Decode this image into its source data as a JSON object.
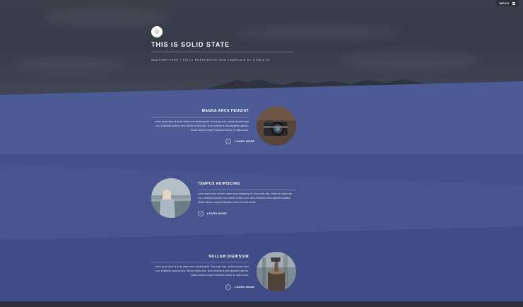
{
  "header": {
    "menu_label": "MENU",
    "logo_icon": "diamond-icon",
    "title": "THIS IS SOLID STATE",
    "tagline": "ANOTHER FREE + FULLY RESPONSIVE SITE TEMPLATE BY HTML5 UP"
  },
  "spotlights": [
    {
      "title": "MAGNA ARCU FEUGIAT",
      "text": "Lorem ipsum dolor sit amet, etiam lorem adipiscing elit. Cras turpis ante, nullam sit amet turpis non, sollicitudin posuere urna. Mauris id tellus arcu. Nunc vehicula id nulla dignissim dapibus. Nullam ultrices, neque et faucibus viverra, ex nulla cursus.",
      "link": "LEARN MORE",
      "image": "camera"
    },
    {
      "title": "TEMPUS ADIPISCING",
      "text": "Lorem ipsum dolor sit amet, etiam lorem adipiscing elit. Cras turpis ante, nullam sit amet turpis non, sollicitudin posuere urna. Mauris id tellus arcu. Nunc vehicula id nulla dignissim dapibus. Nullam ultrices, neque et faucibus viverra, ex nulla cursus.",
      "link": "LEARN MORE",
      "image": "person-by-sea"
    },
    {
      "title": "NULLAM DIGNISSIM",
      "text": "Lorem ipsum dolor sit amet, etiam lorem adipiscing elit. Cras turpis ante, nullam sit amet turpis non, sollicitudin posuere urna. Mauris id tellus arcu. Nunc vehicula id nulla dignissim dapibus. Nullam ultrices, neque et faucibus viverra, ex nulla cursus.",
      "link": "LEARN MORE",
      "image": "axe-in-stump"
    }
  ],
  "colors": {
    "banner": "#3a3f4a",
    "wrapper_1": "#4c5a96",
    "wrapper_2": "#43508c",
    "wrapper_3": "#3f4c87"
  }
}
